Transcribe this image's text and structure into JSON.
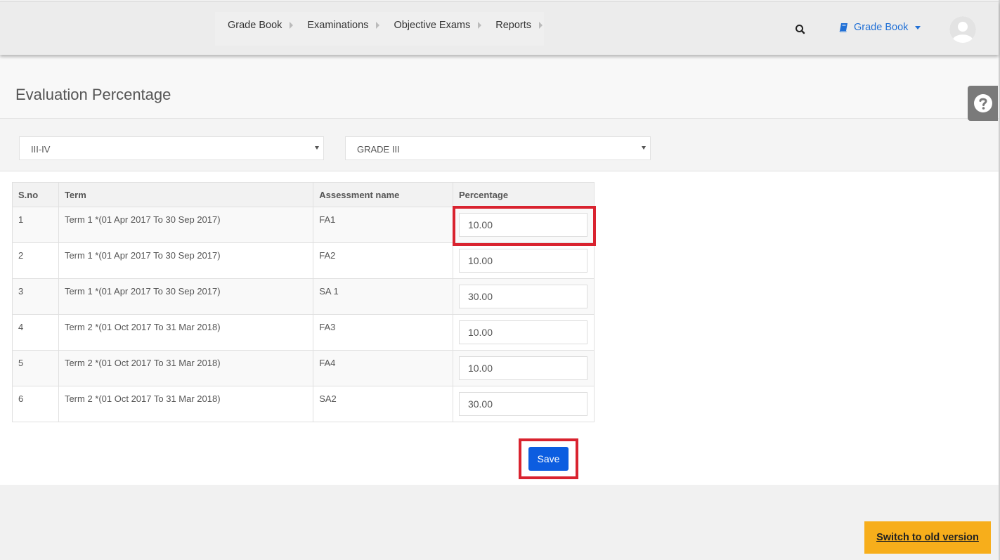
{
  "nav": {
    "items": [
      {
        "label": "Grade Book"
      },
      {
        "label": "Examinations"
      },
      {
        "label": "Objective Exams"
      },
      {
        "label": "Reports"
      }
    ],
    "module_label": "Grade Book",
    "icons": {
      "search": "search-icon",
      "module": "book-icon",
      "avatar": "user-avatar-icon",
      "help": "question-icon"
    }
  },
  "page": {
    "title": "Evaluation Percentage"
  },
  "filters": {
    "group_value": "III-IV",
    "grade_value": "GRADE III"
  },
  "table": {
    "headers": {
      "sno": "S.no",
      "term": "Term",
      "assessment": "Assessment name",
      "percentage": "Percentage"
    },
    "rows": [
      {
        "sno": "1",
        "term": "Term 1 *(01 Apr 2017 To 30 Sep 2017)",
        "assessment": "FA1",
        "percentage": "10.00"
      },
      {
        "sno": "2",
        "term": "Term 1 *(01 Apr 2017 To 30 Sep 2017)",
        "assessment": "FA2",
        "percentage": "10.00"
      },
      {
        "sno": "3",
        "term": "Term 1 *(01 Apr 2017 To 30 Sep 2017)",
        "assessment": "SA 1",
        "percentage": "30.00"
      },
      {
        "sno": "4",
        "term": "Term 2 *(01 Oct 2017 To 31 Mar 2018)",
        "assessment": "FA3",
        "percentage": "10.00"
      },
      {
        "sno": "5",
        "term": "Term 2 *(01 Oct 2017 To 31 Mar 2018)",
        "assessment": "FA4",
        "percentage": "10.00"
      },
      {
        "sno": "6",
        "term": "Term 2 *(01 Oct 2017 To 31 Mar 2018)",
        "assessment": "SA2",
        "percentage": "30.00"
      }
    ]
  },
  "actions": {
    "save_label": "Save",
    "switch_label": "Switch to old version"
  },
  "colors": {
    "accent": "#0c5de0",
    "link": "#2170d6",
    "highlight": "#d9232f",
    "switch_bg": "#f7ae1b"
  }
}
